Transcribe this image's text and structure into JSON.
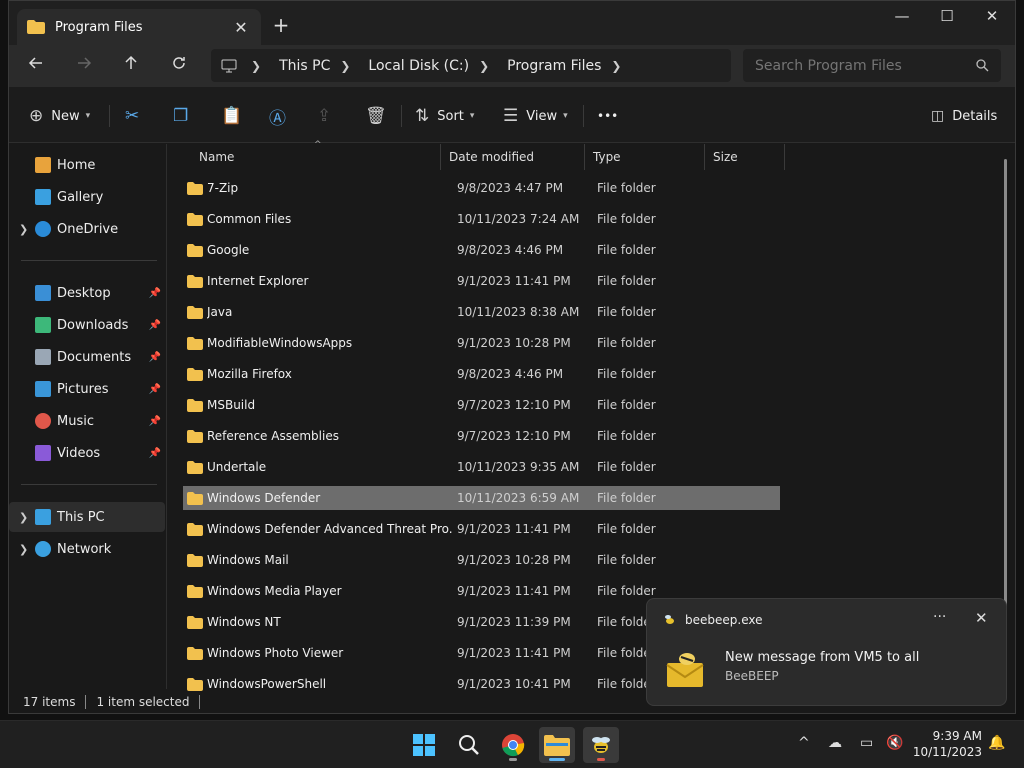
{
  "window": {
    "tab_title": "Program Files",
    "new_tab_glyph": "+",
    "close_tab_glyph": "✕",
    "minimize_glyph": "—",
    "maximize_glyph": "☐",
    "close_glyph": "✕"
  },
  "nav": {
    "back_icon": "arrow-left-icon",
    "forward_icon": "arrow-right-icon",
    "up_icon": "arrow-up-icon",
    "refresh_icon": "refresh-icon",
    "breadcrumb": [
      "This PC",
      "Local Disk (C:)",
      "Program Files"
    ],
    "search_placeholder": "Search Program Files"
  },
  "commands": {
    "new_label": "New",
    "sort_label": "Sort",
    "view_label": "View",
    "more_label": "•••",
    "details_label": "Details"
  },
  "sidebar": {
    "quick": [
      {
        "label": "Home",
        "color": "#e8a33c"
      },
      {
        "label": "Gallery",
        "color": "#3aa0e0"
      },
      {
        "label": "OneDrive",
        "color": "#2a8bd8"
      }
    ],
    "pinned": [
      {
        "label": "Desktop",
        "color": "#3a8fd6"
      },
      {
        "label": "Downloads",
        "color": "#3db87a"
      },
      {
        "label": "Documents",
        "color": "#9aa7b5"
      },
      {
        "label": "Pictures",
        "color": "#3a96d8"
      },
      {
        "label": "Music",
        "color": "#e0574a"
      },
      {
        "label": "Videos",
        "color": "#8a5ad8"
      }
    ],
    "devices": [
      {
        "label": "This PC",
        "color": "#3aa0e0"
      },
      {
        "label": "Network",
        "color": "#3aa0e0"
      }
    ]
  },
  "columns": {
    "name": "Name",
    "date": "Date modified",
    "type": "Type",
    "size": "Size"
  },
  "files": [
    {
      "name": "7-Zip",
      "date": "9/8/2023 4:47 PM",
      "type": "File folder"
    },
    {
      "name": "Common Files",
      "date": "10/11/2023 7:24 AM",
      "type": "File folder"
    },
    {
      "name": "Google",
      "date": "9/8/2023 4:46 PM",
      "type": "File folder"
    },
    {
      "name": "Internet Explorer",
      "date": "9/1/2023 11:41 PM",
      "type": "File folder"
    },
    {
      "name": "Java",
      "date": "10/11/2023 8:38 AM",
      "type": "File folder"
    },
    {
      "name": "ModifiableWindowsApps",
      "date": "9/1/2023 10:28 PM",
      "type": "File folder"
    },
    {
      "name": "Mozilla Firefox",
      "date": "9/8/2023 4:46 PM",
      "type": "File folder"
    },
    {
      "name": "MSBuild",
      "date": "9/7/2023 12:10 PM",
      "type": "File folder"
    },
    {
      "name": "Reference Assemblies",
      "date": "9/7/2023 12:10 PM",
      "type": "File folder"
    },
    {
      "name": "Undertale",
      "date": "10/11/2023 9:35 AM",
      "type": "File folder"
    },
    {
      "name": "Windows Defender",
      "date": "10/11/2023 6:59 AM",
      "type": "File folder",
      "selected": true
    },
    {
      "name": "Windows Defender Advanced Threat Pro...",
      "date": "9/1/2023 11:41 PM",
      "type": "File folder"
    },
    {
      "name": "Windows Mail",
      "date": "9/1/2023 10:28 PM",
      "type": "File folder"
    },
    {
      "name": "Windows Media Player",
      "date": "9/1/2023 11:41 PM",
      "type": "File folder"
    },
    {
      "name": "Windows NT",
      "date": "9/1/2023 11:39 PM",
      "type": "File folder"
    },
    {
      "name": "Windows Photo Viewer",
      "date": "9/1/2023 11:41 PM",
      "type": "File folder"
    },
    {
      "name": "WindowsPowerShell",
      "date": "9/1/2023 10:41 PM",
      "type": "File folder"
    }
  ],
  "status": {
    "items": "17 items",
    "selected": "1 item selected"
  },
  "notification": {
    "app": "beebeep.exe",
    "title": "New message from VM5 to all",
    "subtitle": "BeeBEEP",
    "more": "···",
    "close": "✕"
  },
  "taskbar": {
    "time": "9:39 AM",
    "date": "10/11/2023",
    "tray_chevron": "^"
  },
  "colors": {
    "folder": "#f2c14e",
    "selection": "#6d6d6d",
    "accent": "#60b4f0"
  }
}
